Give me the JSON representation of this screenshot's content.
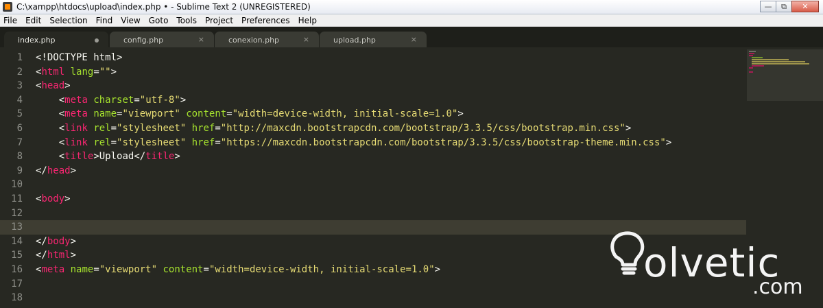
{
  "window": {
    "title": "C:\\xampp\\htdocs\\upload\\index.php • - Sublime Text 2 (UNREGISTERED)",
    "controls": [
      "minimize-icon",
      "restore-icon",
      "close-icon"
    ]
  },
  "menu": [
    "File",
    "Edit",
    "Selection",
    "Find",
    "View",
    "Goto",
    "Tools",
    "Project",
    "Preferences",
    "Help"
  ],
  "tabs": [
    {
      "label": "index.php",
      "active": true,
      "modified": true
    },
    {
      "label": "config.php",
      "active": false,
      "close": "×"
    },
    {
      "label": "conexion.php",
      "active": false,
      "close": "×"
    },
    {
      "label": "upload.php",
      "active": false,
      "close": "×"
    }
  ],
  "editor": {
    "current_line": 13,
    "line_numbers": [
      "1",
      "2",
      "3",
      "4",
      "5",
      "6",
      "7",
      "8",
      "9",
      "10",
      "11",
      "12",
      "13",
      "14",
      "15",
      "16",
      "17",
      "18"
    ],
    "code": {
      "l1": "<!DOCTYPE html>",
      "l2": {
        "open": "<",
        "tag": "html",
        "attr": "lang",
        "eq": "=",
        "val": "\"\"",
        "close": ">"
      },
      "l3": {
        "open": "<",
        "tag": "head",
        "close": ">"
      },
      "l4": {
        "open": "<",
        "tag": "meta",
        "attr": "charset",
        "eq": "=",
        "val": "\"utf-8\"",
        "close": ">"
      },
      "l5": {
        "open": "<",
        "tag": "meta",
        "attr1": "name",
        "val1": "\"viewport\"",
        "attr2": "content",
        "val2": "\"width=device-width, initial-scale=1.0\"",
        "close": ">"
      },
      "l6": {
        "open": "<",
        "tag": "link",
        "attr1": "rel",
        "val1": "\"stylesheet\"",
        "attr2": "href",
        "val2": "\"http://maxcdn.bootstrapcdn.com/bootstrap/3.3.5/css/bootstrap.min.css\"",
        "close": ">"
      },
      "l7": {
        "open": "<",
        "tag": "link",
        "attr1": "rel",
        "val1": "\"stylesheet\"",
        "attr2": "href",
        "val2": "\"https://maxcdn.bootstrapcdn.com/bootstrap/3.3.5/css/bootstrap-theme.min.css\"",
        "close": ">"
      },
      "l8": {
        "open": "<",
        "tag": "title",
        "mid": ">Upload</",
        "tag2": "title",
        "close": ">"
      },
      "l9": {
        "open": "</",
        "tag": "head",
        "close": ">"
      },
      "l11": {
        "open": "<",
        "tag": "body",
        "close": ">"
      },
      "l14": {
        "open": "</",
        "tag": "body",
        "close": ">"
      },
      "l15": {
        "open": "</",
        "tag": "html",
        "close": ">"
      },
      "l16": {
        "open": "<",
        "tag": "meta",
        "attr1": "name",
        "val1": "\"viewport\"",
        "attr2": "content",
        "val2": "\"width=device-width, initial-scale=1.0\"",
        "close": ">"
      }
    }
  },
  "watermark": {
    "text": "olvetic",
    "suffix": ".com"
  },
  "colors": {
    "background": "#272822",
    "tag": "#f92672",
    "attribute": "#a6e22e",
    "string": "#e6db74",
    "text": "#f8f8f2",
    "line_number": "#8f908a",
    "current_line": "#3e3d32"
  }
}
